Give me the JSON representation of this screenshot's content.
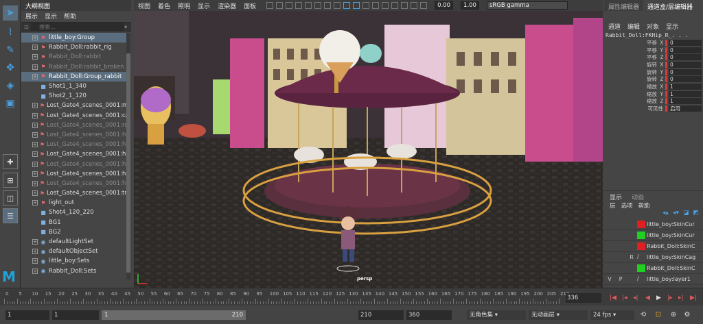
{
  "outliner": {
    "title": "大纲视图",
    "menu": [
      "展示",
      "显示",
      "帮助"
    ],
    "search_placeholder": "搜索...",
    "items": [
      {
        "label": "little_boy:Group",
        "type": "group",
        "state": "selected"
      },
      {
        "label": "Rabbit_Doll:rabbit_rig",
        "type": "group",
        "state": "normal"
      },
      {
        "label": "Rabbit_Doll:rabbit",
        "type": "group",
        "state": "dim"
      },
      {
        "label": "Rabbit_Doll:rabbit_broken",
        "type": "group",
        "state": "dim"
      },
      {
        "label": "Rabbit_Doll:Group_rabbit",
        "type": "group",
        "state": "selected"
      },
      {
        "label": "Shot1_1_340",
        "type": "camera",
        "state": "normal"
      },
      {
        "label": "Shot2_1_120",
        "type": "camera",
        "state": "normal"
      },
      {
        "label": "Lost_Gate4_scenes_0001:m",
        "type": "group",
        "state": "normal"
      },
      {
        "label": "Lost_Gate4_scenes_0001:ca",
        "type": "group",
        "state": "normal"
      },
      {
        "label": "Lost_Gate4_scenes_0001:ro",
        "type": "group",
        "state": "dim"
      },
      {
        "label": "Lost_Gate4_scenes_0001:ho",
        "type": "group",
        "state": "dim"
      },
      {
        "label": "Lost_Gate4_scenes_0001:ho",
        "type": "group",
        "state": "dim"
      },
      {
        "label": "Lost_Gate4_scenes_0001:ho",
        "type": "group",
        "state": "normal"
      },
      {
        "label": "Lost_Gate4_scenes_0001:ho",
        "type": "group",
        "state": "dim"
      },
      {
        "label": "Lost_Gate4_scenes_0001:ho",
        "type": "group",
        "state": "normal"
      },
      {
        "label": "Lost_Gate4_scenes_0001:ho",
        "type": "group",
        "state": "dim"
      },
      {
        "label": "Lost_Gate4_scenes_0001:tra",
        "type": "group",
        "state": "normal"
      },
      {
        "label": "light_out",
        "type": "group",
        "state": "normal"
      },
      {
        "label": "Shot4_120_220",
        "type": "camera",
        "state": "normal"
      },
      {
        "label": "BG1",
        "type": "camera",
        "state": "normal"
      },
      {
        "label": "BG2",
        "type": "camera",
        "state": "normal"
      },
      {
        "label": "defaultLightSet",
        "type": "set",
        "state": "normal"
      },
      {
        "label": "defaultObjectSet",
        "type": "set",
        "state": "normal"
      },
      {
        "label": "little_boy:Sets",
        "type": "set",
        "state": "normal"
      },
      {
        "label": "Rabbit_Doll:Sets",
        "type": "set",
        "state": "normal"
      }
    ]
  },
  "viewport": {
    "menu": [
      "视图",
      "着色",
      "照明",
      "显示",
      "渲染器",
      "面板"
    ],
    "exposure": "0.00",
    "gamma": "1.00",
    "color_space": "sRGB gamma",
    "camera_label": "persp"
  },
  "right_panel": {
    "tabs": [
      "属性编辑器",
      "通道盒/层编辑器"
    ],
    "channel_menu": [
      "通道",
      "编辑",
      "对象",
      "显示"
    ],
    "object_name": "Rabbit_Doll:FKHip_R_.  .  .",
    "attributes": [
      {
        "label": "平移 X",
        "value": "0"
      },
      {
        "label": "平移 Y",
        "value": "0"
      },
      {
        "label": "平移 Z",
        "value": "0"
      },
      {
        "label": "旋转 X",
        "value": "0"
      },
      {
        "label": "旋转 Y",
        "value": "0"
      },
      {
        "label": "旋转 Z",
        "value": "0"
      },
      {
        "label": "缩放 X",
        "value": "1"
      },
      {
        "label": "缩放 Y",
        "value": "1"
      },
      {
        "label": "缩放 Z",
        "value": "1"
      },
      {
        "label": "可见性",
        "value": "启用"
      }
    ],
    "layer_tabs": [
      "显示",
      "动画"
    ],
    "layer_menu": [
      "层",
      "选项",
      "帮助"
    ],
    "layers": [
      {
        "v": "",
        "p": "",
        "r": "",
        "color": "#e02020",
        "name": "little_boy:SkinCur"
      },
      {
        "v": "",
        "p": "",
        "r": "",
        "color": "#20d020",
        "name": "little_boy:SkinCur"
      },
      {
        "v": "",
        "p": "",
        "r": "",
        "color": "#e02020",
        "name": "Rabbit_Doll:SkinC"
      },
      {
        "v": "",
        "p": "",
        "r": "R",
        "color": "",
        "name": "little_boy:SkinCag"
      },
      {
        "v": "",
        "p": "",
        "r": "",
        "color": "#20d020",
        "name": "Rabbit_Doll:SkinC"
      },
      {
        "v": "V",
        "p": "P",
        "r": "",
        "color": "",
        "name": "little_boy:layer1"
      }
    ]
  },
  "timeline": {
    "ticks": [
      "0",
      "5",
      "10",
      "15",
      "20",
      "25",
      "30",
      "35",
      "40",
      "45",
      "50",
      "55",
      "60",
      "65",
      "70",
      "75",
      "80",
      "85",
      "90",
      "95",
      "100",
      "105",
      "110",
      "115",
      "120",
      "125",
      "130",
      "135",
      "140",
      "145",
      "150",
      "155",
      "160",
      "165",
      "170",
      "175",
      "180",
      "185",
      "190",
      "195",
      "200",
      "205",
      "210"
    ],
    "current_frame": "336"
  },
  "range": {
    "start": "1",
    "playback_start": "1",
    "slider_start": "1",
    "slider_end": "210",
    "playback_end": "210",
    "end": "360",
    "char_set": "无角色集",
    "anim_layer": "无动画层",
    "fps": "24 fps"
  }
}
